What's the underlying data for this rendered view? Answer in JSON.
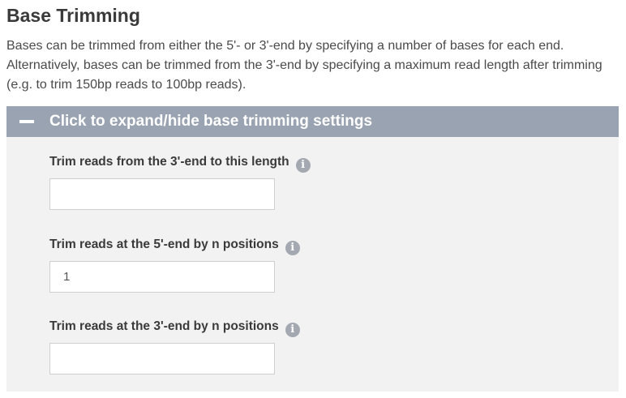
{
  "section": {
    "title": "Base Trimming",
    "description": "Bases can be trimmed from either the 5'- or 3'-end by specifying a number of bases for each end. Alternatively, bases can be trimmed from the 3'-end by specifying a maximum read length after trimming (e.g. to trim 150bp reads to 100bp reads)."
  },
  "panel": {
    "header_label": "Click to expand/hide base trimming settings",
    "expanded": true,
    "header_color": "#9aa3b1",
    "background_color": "#f2f2f2"
  },
  "fields": {
    "max_length": {
      "label": "Trim reads from the 3'-end to this length",
      "value": "",
      "info_icon": "info-circle-icon"
    },
    "trim_5": {
      "label": "Trim reads at the 5'-end by n positions",
      "value": "1",
      "info_icon": "info-circle-icon"
    },
    "trim_3": {
      "label": "Trim reads at the 3'-end by n positions",
      "value": "",
      "info_icon": "info-circle-icon"
    }
  }
}
